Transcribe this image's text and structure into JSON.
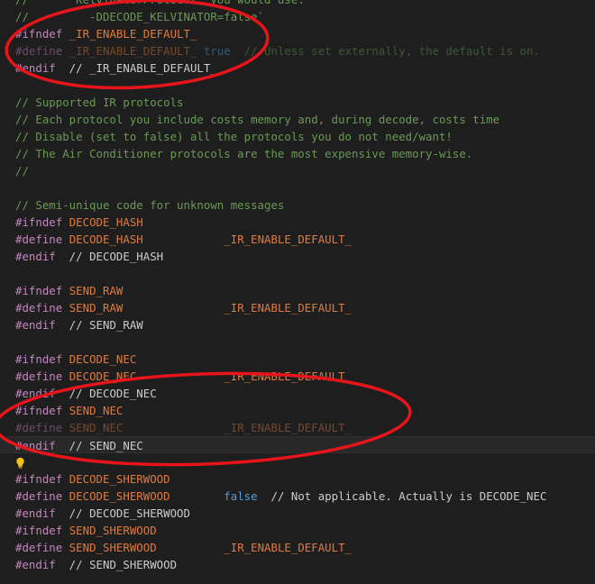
{
  "editor": {
    "lines": [
      {
        "segs": [
          {
            "c": "cmt",
            "t": "//       KelvinatorProtocol, you would use:"
          }
        ]
      },
      {
        "segs": [
          {
            "c": "cmt",
            "t": "//         -DDECODE_KELVINATOR=false`"
          }
        ]
      },
      {
        "segs": [
          {
            "c": "kw",
            "t": "#ifndef"
          },
          {
            "c": "plain",
            "t": " "
          },
          {
            "c": "mac",
            "t": "_IR_ENABLE_DEFAULT_"
          }
        ]
      },
      {
        "dim": true,
        "segs": [
          {
            "c": "kw",
            "t": "#define"
          },
          {
            "c": "plain",
            "t": " "
          },
          {
            "c": "mac",
            "t": "_IR_ENABLE_DEFAULT_"
          },
          {
            "c": "plain",
            "t": " "
          },
          {
            "c": "bool",
            "t": "true"
          },
          {
            "c": "plain",
            "t": "  "
          },
          {
            "c": "cmt",
            "t": "// Unless set externally, the default is on."
          }
        ]
      },
      {
        "segs": [
          {
            "c": "kw",
            "t": "#endif"
          },
          {
            "c": "plain",
            "t": "  // _IR_ENABLE_DEFAULT_"
          }
        ]
      },
      {
        "segs": []
      },
      {
        "segs": [
          {
            "c": "cmt",
            "t": "// Supported IR protocols"
          }
        ]
      },
      {
        "segs": [
          {
            "c": "cmt",
            "t": "// Each protocol you include costs memory and, during decode, costs time"
          }
        ]
      },
      {
        "segs": [
          {
            "c": "cmt",
            "t": "// Disable (set to false) all the protocols you do not need/want!"
          }
        ]
      },
      {
        "segs": [
          {
            "c": "cmt",
            "t": "// The Air Conditioner protocols are the most expensive memory-wise."
          }
        ]
      },
      {
        "segs": [
          {
            "c": "cmt",
            "t": "//"
          }
        ]
      },
      {
        "segs": []
      },
      {
        "segs": [
          {
            "c": "cmt",
            "t": "// Semi-unique code for unknown messages"
          }
        ]
      },
      {
        "segs": [
          {
            "c": "kw",
            "t": "#ifndef"
          },
          {
            "c": "plain",
            "t": " "
          },
          {
            "c": "mac",
            "t": "DECODE_HASH"
          }
        ]
      },
      {
        "segs": [
          {
            "c": "kw",
            "t": "#define"
          },
          {
            "c": "plain",
            "t": " "
          },
          {
            "c": "mac",
            "t": "DECODE_HASH"
          },
          {
            "c": "plain",
            "t": "            "
          },
          {
            "c": "val",
            "t": "_IR_ENABLE_DEFAULT_"
          }
        ]
      },
      {
        "segs": [
          {
            "c": "kw",
            "t": "#endif"
          },
          {
            "c": "plain",
            "t": "  // DECODE_HASH"
          }
        ]
      },
      {
        "segs": []
      },
      {
        "segs": [
          {
            "c": "kw",
            "t": "#ifndef"
          },
          {
            "c": "plain",
            "t": " "
          },
          {
            "c": "mac",
            "t": "SEND_RAW"
          }
        ]
      },
      {
        "segs": [
          {
            "c": "kw",
            "t": "#define"
          },
          {
            "c": "plain",
            "t": " "
          },
          {
            "c": "mac",
            "t": "SEND_RAW"
          },
          {
            "c": "plain",
            "t": "               "
          },
          {
            "c": "val",
            "t": "_IR_ENABLE_DEFAULT_"
          }
        ]
      },
      {
        "segs": [
          {
            "c": "kw",
            "t": "#endif"
          },
          {
            "c": "plain",
            "t": "  // SEND_RAW"
          }
        ]
      },
      {
        "segs": []
      },
      {
        "segs": [
          {
            "c": "kw",
            "t": "#ifndef"
          },
          {
            "c": "plain",
            "t": " "
          },
          {
            "c": "mac",
            "t": "DECODE_NEC"
          }
        ]
      },
      {
        "segs": [
          {
            "c": "kw",
            "t": "#define"
          },
          {
            "c": "plain",
            "t": " "
          },
          {
            "c": "mac",
            "t": "DECODE_NEC"
          },
          {
            "c": "plain",
            "t": "             "
          },
          {
            "c": "val",
            "t": "_IR_ENABLE_DEFAULT_"
          }
        ]
      },
      {
        "segs": [
          {
            "c": "kw",
            "t": "#endif"
          },
          {
            "c": "plain",
            "t": "  // DECODE_NEC"
          }
        ]
      },
      {
        "segs": [
          {
            "c": "kw",
            "t": "#ifndef"
          },
          {
            "c": "plain",
            "t": " "
          },
          {
            "c": "mac",
            "t": "SEND_NEC"
          }
        ]
      },
      {
        "dim": true,
        "segs": [
          {
            "c": "kw",
            "t": "#define"
          },
          {
            "c": "plain",
            "t": " "
          },
          {
            "c": "mac",
            "t": "SEND_NEC"
          },
          {
            "c": "plain",
            "t": "               "
          },
          {
            "c": "val",
            "t": "_IR_ENABLE_DEFAULT_"
          }
        ]
      },
      {
        "current": true,
        "segs": [
          {
            "c": "kw",
            "t": "#endif"
          },
          {
            "c": "plain",
            "t": "  // SEND_NEC"
          }
        ]
      },
      {
        "bulb": true,
        "segs": []
      },
      {
        "segs": [
          {
            "c": "kw",
            "t": "#ifndef"
          },
          {
            "c": "plain",
            "t": " "
          },
          {
            "c": "mac",
            "t": "DECODE_SHERWOOD"
          }
        ]
      },
      {
        "segs": [
          {
            "c": "kw",
            "t": "#define"
          },
          {
            "c": "plain",
            "t": " "
          },
          {
            "c": "mac",
            "t": "DECODE_SHERWOOD"
          },
          {
            "c": "plain",
            "t": "        "
          },
          {
            "c": "bool",
            "t": "false"
          },
          {
            "c": "plain",
            "t": "  // Not applicable. Actually is DECODE_NEC"
          }
        ]
      },
      {
        "segs": [
          {
            "c": "kw",
            "t": "#endif"
          },
          {
            "c": "plain",
            "t": "  // DECODE_SHERWOOD"
          }
        ]
      },
      {
        "segs": [
          {
            "c": "kw",
            "t": "#ifndef"
          },
          {
            "c": "plain",
            "t": " "
          },
          {
            "c": "mac",
            "t": "SEND_SHERWOOD"
          }
        ]
      },
      {
        "segs": [
          {
            "c": "kw",
            "t": "#define"
          },
          {
            "c": "plain",
            "t": " "
          },
          {
            "c": "mac",
            "t": "SEND_SHERWOOD"
          },
          {
            "c": "plain",
            "t": "          "
          },
          {
            "c": "val",
            "t": "_IR_ENABLE_DEFAULT_"
          }
        ]
      },
      {
        "segs": [
          {
            "c": "kw",
            "t": "#endif"
          },
          {
            "c": "plain",
            "t": "  // SEND_SHERWOOD"
          }
        ]
      }
    ],
    "lightbulb_icon": "lightbulb-icon",
    "annotation_color": "#e8141b"
  }
}
